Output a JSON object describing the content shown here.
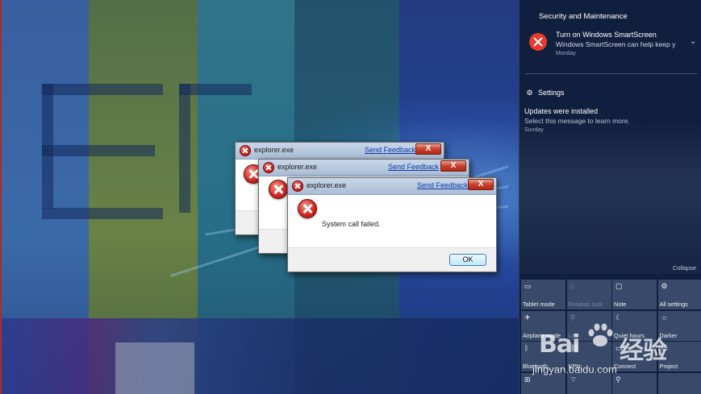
{
  "dialogs": [
    {
      "title": "explorer.exe",
      "link": "Send Feedback",
      "close": "X"
    },
    {
      "title": "explorer.exe",
      "link": "Send Feedback",
      "close": "X"
    },
    {
      "title": "explorer.exe",
      "link": "Send Feedback",
      "close": "X",
      "message": "System call failed.",
      "ok": "OK"
    }
  ],
  "action_center": {
    "group_title": "Security and Maintenance",
    "notification": {
      "title": "Turn on Windows SmartScreen",
      "body": "Windows SmartScreen can help keep y",
      "date": "Monday"
    },
    "settings_title": "Settings",
    "update": {
      "title": "Updates were installed",
      "body": "Select this message to learn more.",
      "date": "Sunday"
    },
    "collapse": "Collapse",
    "tiles": [
      {
        "label": "Tablet mode",
        "icon": "tablet-icon",
        "glyph": "▭",
        "dim": false
      },
      {
        "label": "Rotation lock",
        "icon": "rotation-lock-icon",
        "glyph": "⌂",
        "dim": true
      },
      {
        "label": "Note",
        "icon": "note-icon",
        "glyph": "▢",
        "dim": false
      },
      {
        "label": "All settings",
        "icon": "gear-icon",
        "glyph": "⚙",
        "dim": false
      },
      {
        "label": "Airplane mode",
        "icon": "airplane-icon",
        "glyph": "✈",
        "dim": false
      },
      {
        "label": "Loc",
        "icon": "location-icon",
        "glyph": "⚲",
        "dim": true
      },
      {
        "label": "Quiet hours",
        "icon": "moon-icon",
        "glyph": "☾",
        "dim": false
      },
      {
        "label": "Darker",
        "icon": "brightness-icon",
        "glyph": "☼",
        "dim": false
      },
      {
        "label": "Bluetooth",
        "icon": "bluetooth-icon",
        "glyph": "ᛒ",
        "dim": false
      },
      {
        "label": "VPN",
        "icon": "vpn-icon",
        "glyph": "⛓",
        "dim": false
      },
      {
        "label": "Connect",
        "icon": "connect-icon",
        "glyph": "▭",
        "dim": false
      },
      {
        "label": "Project",
        "icon": "project-icon",
        "glyph": "▭",
        "dim": false
      },
      {
        "label": "",
        "icon": "network-icon",
        "glyph": "⊞",
        "dim": false
      },
      {
        "label": "",
        "icon": "wifi-icon",
        "glyph": "⌔",
        "dim": false
      },
      {
        "label": "",
        "icon": "location-icon",
        "glyph": "⚲",
        "dim": false
      },
      {
        "label": "",
        "icon": "unknown-icon",
        "glyph": "",
        "dim": false
      }
    ]
  },
  "watermark": {
    "brand": "Bai",
    "brand2": "经验",
    "url": "jingyan.baidu.com"
  }
}
